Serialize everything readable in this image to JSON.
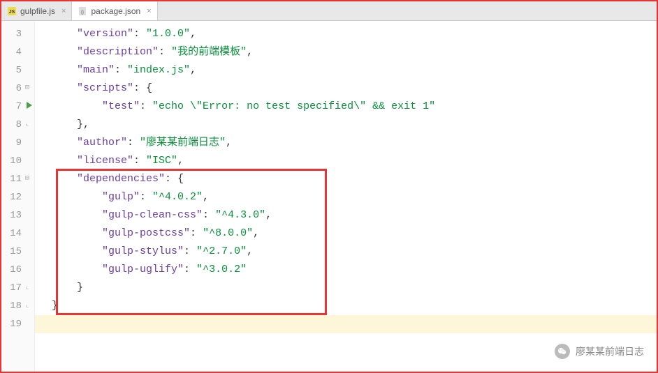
{
  "tabs": [
    {
      "label": "gulpfile.js",
      "active": false
    },
    {
      "label": "package.json",
      "active": true
    }
  ],
  "gutter": {
    "start": 3,
    "end": 19,
    "play_line": 7,
    "fold_open_lines": [
      6,
      11
    ],
    "fold_close_lines": [
      8,
      17,
      18
    ]
  },
  "code": {
    "lines": [
      {
        "n": 3,
        "indent": 2,
        "type": "kv",
        "key": "version",
        "value": "1.0.0",
        "comma": true
      },
      {
        "n": 4,
        "indent": 2,
        "type": "kv",
        "key": "description",
        "value": "我的前端模板",
        "comma": true
      },
      {
        "n": 5,
        "indent": 2,
        "type": "kv",
        "key": "main",
        "value": "index.js",
        "comma": true
      },
      {
        "n": 6,
        "indent": 2,
        "type": "kobj",
        "key": "scripts"
      },
      {
        "n": 7,
        "indent": 4,
        "type": "kv",
        "key": "test",
        "value": "echo \\\"Error: no test specified\\\" && exit 1",
        "comma": false
      },
      {
        "n": 8,
        "indent": 2,
        "type": "close",
        "text": "},",
        "comma": false
      },
      {
        "n": 9,
        "indent": 2,
        "type": "kv",
        "key": "author",
        "value": "廖某某前端日志",
        "comma": true
      },
      {
        "n": 10,
        "indent": 2,
        "type": "kv",
        "key": "license",
        "value": "ISC",
        "comma": true
      },
      {
        "n": 11,
        "indent": 2,
        "type": "kobj",
        "key": "dependencies"
      },
      {
        "n": 12,
        "indent": 4,
        "type": "kv",
        "key": "gulp",
        "value": "^4.0.2",
        "comma": true
      },
      {
        "n": 13,
        "indent": 4,
        "type": "kv",
        "key": "gulp-clean-css",
        "value": "^4.3.0",
        "comma": true
      },
      {
        "n": 14,
        "indent": 4,
        "type": "kv",
        "key": "gulp-postcss",
        "value": "^8.0.0",
        "comma": true
      },
      {
        "n": 15,
        "indent": 4,
        "type": "kv",
        "key": "gulp-stylus",
        "value": "^2.7.0",
        "comma": true
      },
      {
        "n": 16,
        "indent": 4,
        "type": "kv",
        "key": "gulp-uglify",
        "value": "^3.0.2",
        "comma": false
      },
      {
        "n": 17,
        "indent": 2,
        "type": "close",
        "text": "}",
        "comma": false
      },
      {
        "n": 18,
        "indent": 0,
        "type": "close",
        "text": "}",
        "comma": false
      },
      {
        "n": 19,
        "indent": 0,
        "type": "empty"
      }
    ],
    "highlight_line": 19
  },
  "watermark": {
    "text": "廖某某前端日志"
  }
}
